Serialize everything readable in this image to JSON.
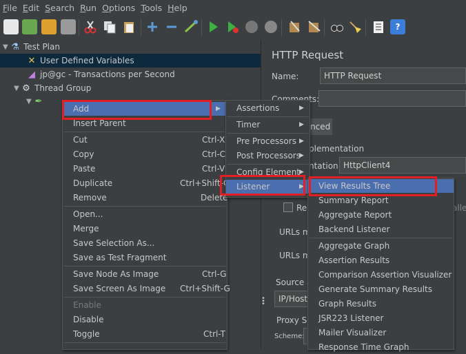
{
  "menubar": [
    {
      "u": "F",
      "rest": "ile"
    },
    {
      "u": "E",
      "rest": "dit"
    },
    {
      "u": "S",
      "rest": "earch"
    },
    {
      "u": "R",
      "rest": "un"
    },
    {
      "u": "O",
      "rest": "ptions"
    },
    {
      "u": "T",
      "rest": "ools"
    },
    {
      "u": "H",
      "rest": "elp"
    }
  ],
  "tree": {
    "test_plan": "Test Plan",
    "user_vars": "User Defined Variables",
    "tps": "jp@gc - Transactions per Second",
    "thread_group": "Thread Group"
  },
  "right": {
    "title": "HTTP Request",
    "name_label": "Name:",
    "name_value": "HTTP Request",
    "comments_label": "Comments:",
    "tab_advanced": "anced",
    "impl_label": "plementation",
    "impl_field_label": "ntation:",
    "impl_value": "HttpClient4",
    "cb_label": "Re",
    "parallel_label": "alle",
    "urls1": "URLs m",
    "urls2": "URLs m",
    "source_label": "Source a",
    "source_value": "IP/Host",
    "proxy_label": "Proxy Se",
    "scheme_label": "Scheme:"
  },
  "context_menu": {
    "add": "Add",
    "insert_parent": "Insert Parent",
    "cut": "Cut",
    "cut_sc": "Ctrl-X",
    "copy": "Copy",
    "copy_sc": "Ctrl-C",
    "paste": "Paste",
    "paste_sc": "Ctrl-V",
    "duplicate": "Duplicate",
    "duplicate_sc": "Ctrl+Shift-C",
    "remove": "Remove",
    "remove_sc": "Delete",
    "open": "Open...",
    "merge": "Merge",
    "save_selection": "Save Selection As...",
    "save_fragment": "Save as Test Fragment",
    "save_node_image": "Save Node As Image",
    "save_node_image_sc": "Ctrl-G",
    "save_screen_image": "Save Screen As Image",
    "save_screen_image_sc": "Ctrl+Shift-G",
    "enable": "Enable",
    "disable": "Disable",
    "toggle": "Toggle",
    "toggle_sc": "Ctrl-T"
  },
  "add_menu": {
    "assertions": "Assertions",
    "timer": "Timer",
    "pre_processors": "Pre Processors",
    "post_processors": "Post Processors",
    "config_element": "Config Element",
    "listener": "Listener"
  },
  "listener_menu": {
    "items_a": [
      "View Results Tree",
      "Summary Report",
      "Aggregate Report",
      "Backend Listener"
    ],
    "items_b": [
      "Aggregate Graph",
      "Assertion Results",
      "Comparison Assertion Visualizer",
      "Generate Summary Results",
      "Graph Results",
      "JSR223 Listener",
      "Mailer Visualizer",
      "Response Time Graph"
    ]
  },
  "colors": {
    "background": "#3c3f41",
    "highlight": "#4b6eaf",
    "annotation_red": "#e31e24",
    "selection": "#0d293e"
  }
}
